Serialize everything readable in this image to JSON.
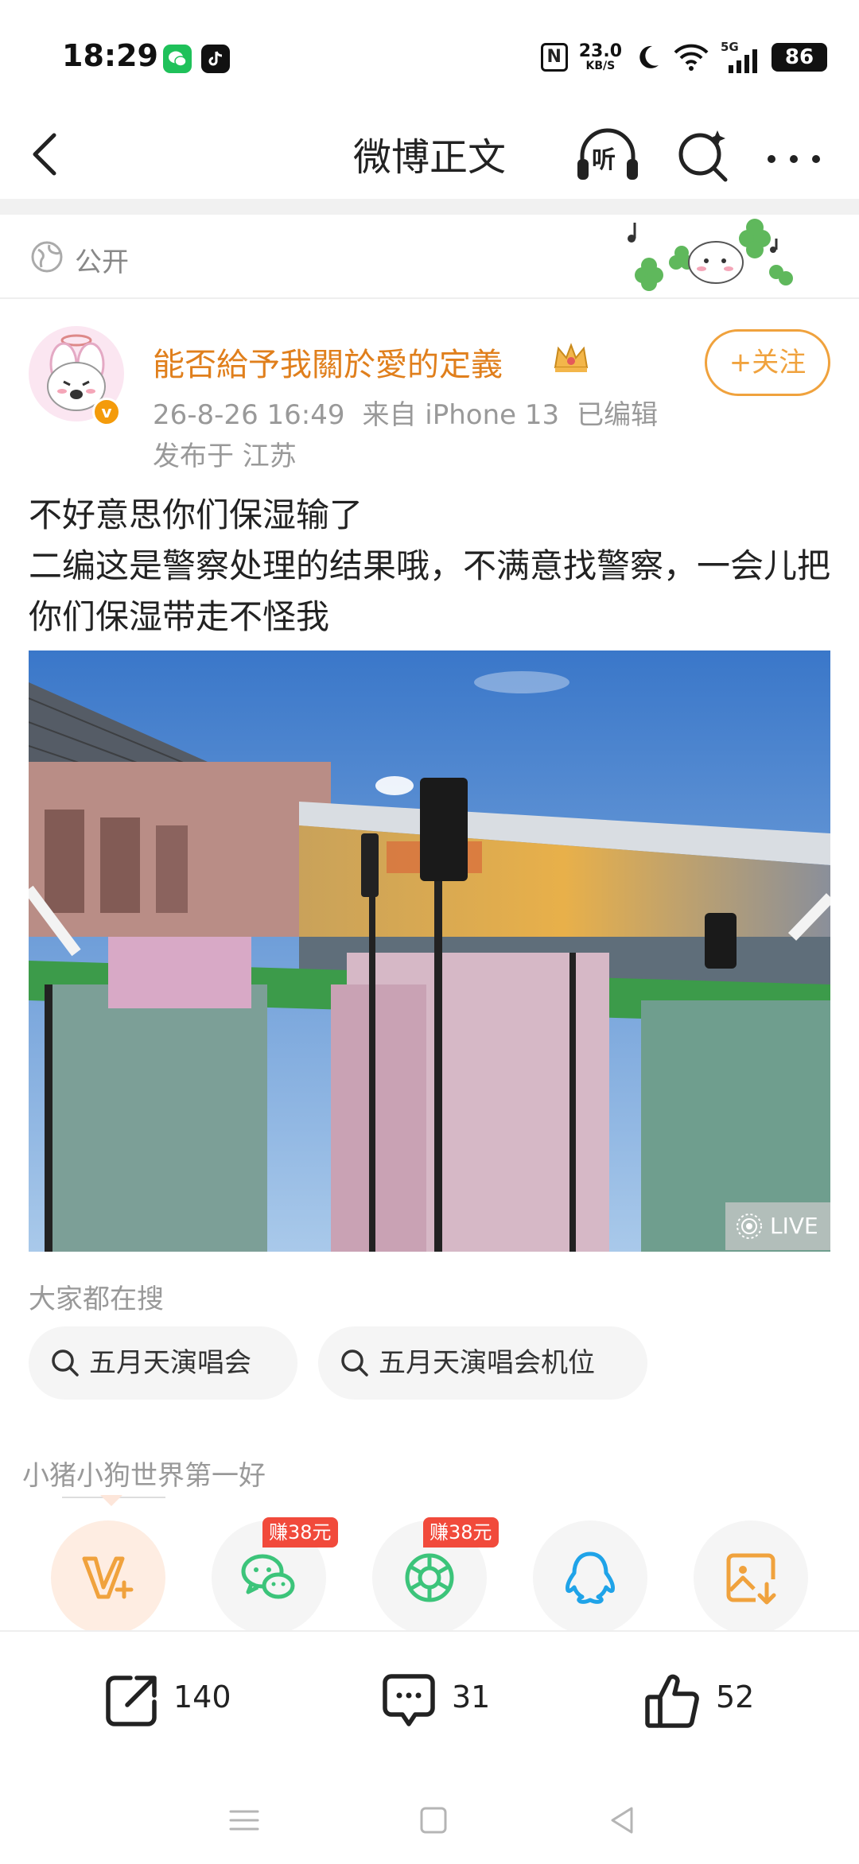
{
  "status_bar": {
    "time": "18:29",
    "speed_value": "23.0",
    "speed_unit": "KB/S",
    "battery": "86",
    "signal": "5G",
    "nfc": "N"
  },
  "nav": {
    "title": "微博正文",
    "listen_label": "听"
  },
  "visibility": {
    "label": "公开"
  },
  "post": {
    "author": "能否給予我關於愛的定義",
    "date": "26-8-26 16:49",
    "source": "来自 iPhone 13",
    "edited": "已编辑",
    "location": "发布于 江苏",
    "follow_label": "+关注",
    "verified_badge": "v",
    "lines": [
      "不好意思你们保湿输了",
      "二编这是警察处理的结果哦，不满意找警察，一会儿把你们保湿带走不怪我"
    ],
    "live_label": "LIVE"
  },
  "suggestions": {
    "title": "大家都在搜",
    "items": [
      "五月天演唱会",
      "五月天演唱会机位"
    ]
  },
  "share": {
    "title": "小猪小狗世界第一好",
    "earn_tags": [
      "赚38元",
      "赚38元"
    ],
    "icons": [
      "weibo-vplus-icon",
      "wechat-icon",
      "moments-icon",
      "qq-icon",
      "save-image-icon"
    ]
  },
  "actions": {
    "repost_count": "140",
    "comment_count": "31",
    "like_count": "52"
  },
  "colors": {
    "accent_orange": "#e07f1c",
    "follow_orange": "#f0a23d",
    "wechat_green": "#3cc47a",
    "qq_blue": "#1fa3e8",
    "earn_red": "#f14a3b"
  }
}
